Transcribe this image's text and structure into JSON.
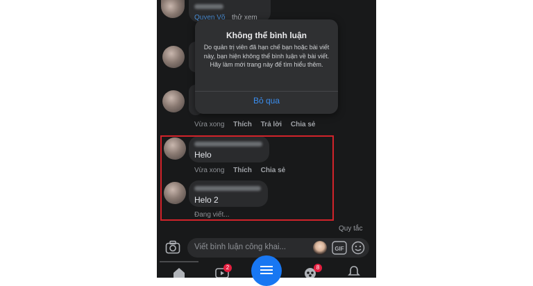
{
  "comments_above": {
    "first_reply_link": "Quyen Võ",
    "first_reply_text": "thử xem"
  },
  "dialog": {
    "title": "Không thể bình luận",
    "message": "Do quản trị viên đã hạn chế bạn hoặc bài viết này, bạn hiện không thể bình luận về bài viết. Hãy làm mới trang này để tìm hiểu thêm.",
    "button": "Bỏ qua"
  },
  "comment_actions_top": {
    "time": "Vừa xong",
    "like": "Thích",
    "reply": "Trả lời",
    "share": "Chia sẻ"
  },
  "comments": [
    {
      "text": "Helo",
      "time": "Vừa xong",
      "like": "Thích",
      "share": "Chia sẻ"
    },
    {
      "text": "Helo 2",
      "status": "Đang viết..."
    }
  ],
  "rules_link": "Quy tắc",
  "composer": {
    "placeholder": "Viết bình luận công khai..."
  },
  "bottom_nav": {
    "video_badge": "2",
    "groups_badge": "8"
  },
  "colors": {
    "highlight_box": "#d2232a",
    "link": "#4a8fd8",
    "badge": "#e41e3f",
    "menu_button": "#1877f2"
  }
}
